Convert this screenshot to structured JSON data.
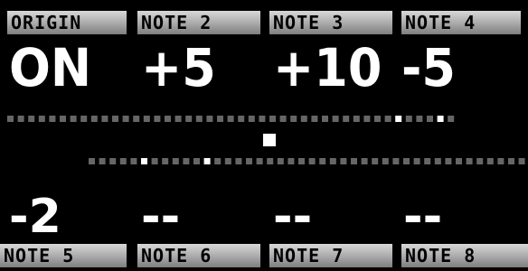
{
  "top_row": [
    {
      "label": "ORIGIN",
      "value": "ON"
    },
    {
      "label": "NOTE 2",
      "value": "+5"
    },
    {
      "label": "NOTE 3",
      "value": "+10"
    },
    {
      "label": "NOTE 4",
      "value": "-5"
    }
  ],
  "bottom_row": [
    {
      "label": "NOTE 5",
      "value": "-2"
    },
    {
      "label": "NOTE 6",
      "value": "--"
    },
    {
      "label": "NOTE 7",
      "value": "--"
    },
    {
      "label": "NOTE 8",
      "value": "--"
    }
  ],
  "colors": {
    "background": "#000000",
    "tab_light": "#d8d8d8",
    "tab_dark": "#7e7e7e",
    "value_text": "#ffffff",
    "dot_dim": "#666666",
    "dot_bright": "#ffffff"
  }
}
